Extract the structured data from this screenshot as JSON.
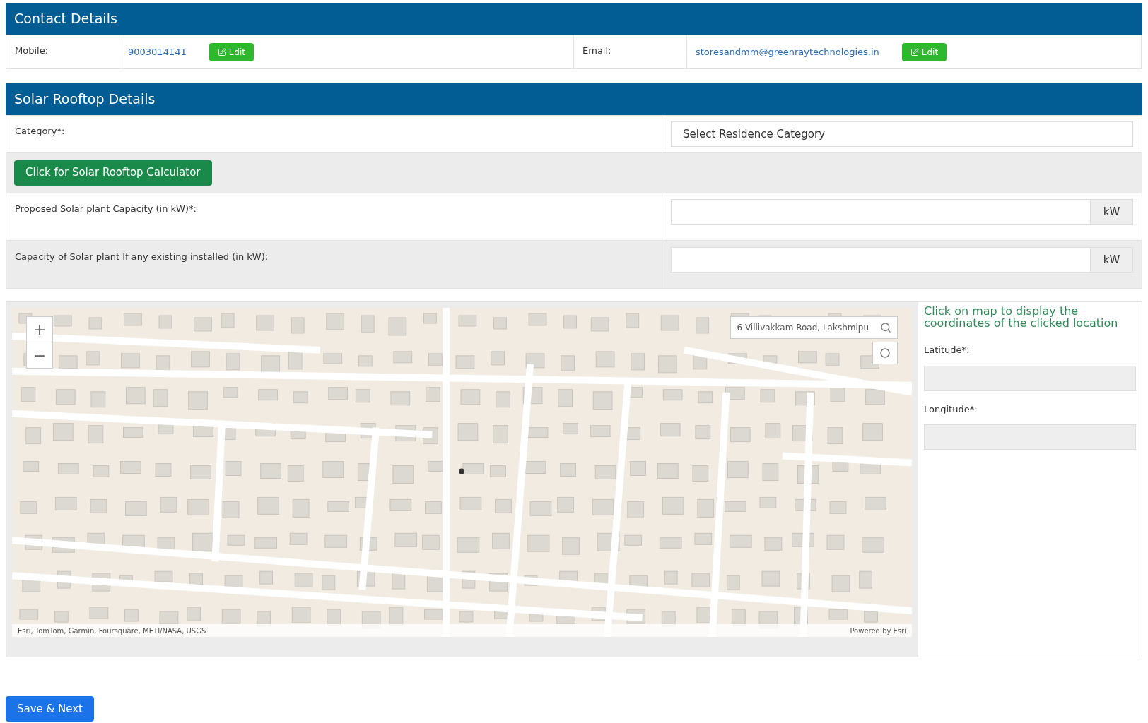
{
  "contact": {
    "title": "Contact Details",
    "fields": [
      {
        "label": "Mobile:",
        "value": "9003014141",
        "button": "Edit"
      },
      {
        "label": "Email:",
        "value": "storesandmm@greenraytechnologies.in",
        "button": "Edit"
      }
    ]
  },
  "solar": {
    "title": "Solar Rooftop Details",
    "category": {
      "label": "Category*:",
      "placeholder": "Select Residence Category"
    },
    "calculator_button": "Click for Solar Rooftop Calculator",
    "capacities": [
      {
        "label": "Proposed Solar plant Capacity (in kW)*:",
        "unit": "kW"
      },
      {
        "label": "Capacity of Solar plant If any existing installed (in kW):",
        "unit": "kW"
      }
    ]
  },
  "map": {
    "search_value": "6 Villivakkam Road, Lakshmipu",
    "attribution": "Esri, TomTom, Garmin, Foursquare, METI/NASA, USGS",
    "powered_by": "Powered by Esri",
    "zoom_in": "+",
    "zoom_out": "−"
  },
  "coordinates": {
    "hint": "Click on map to display the coordinates of the clicked location",
    "latitude_label": "Latitude*:",
    "longitude_label": "Longitude*:"
  },
  "save_button": "Save & Next"
}
